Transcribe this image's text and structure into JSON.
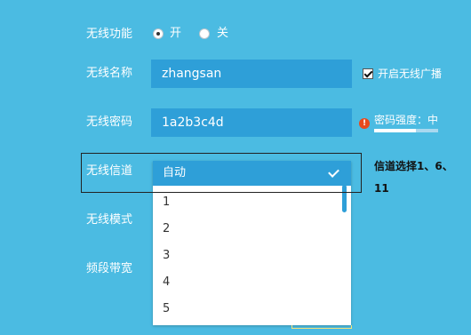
{
  "wireless_function": {
    "label": "无线功能",
    "on_label": "开",
    "off_label": "关",
    "selected": "开"
  },
  "wireless_name": {
    "label": "无线名称",
    "value": "zhangsan",
    "broadcast_label": "开启无线广播",
    "broadcast_checked": true
  },
  "wireless_password": {
    "label": "无线密码",
    "value": "1a2b3c4d",
    "strength_label": "密码强度：中",
    "strength_level": 0.65,
    "warning_icon": "exclamation-icon"
  },
  "wireless_channel": {
    "label": "无线信道",
    "selected": "自动",
    "options": [
      "1",
      "2",
      "3",
      "4",
      "5"
    ],
    "note_line1": "信道选择1、6、",
    "note_line2": "11"
  },
  "wireless_mode": {
    "label": "无线模式"
  },
  "band_width": {
    "label": "频段带宽"
  },
  "colors": {
    "background": "#4bbbe2",
    "field": "#2e9fd8",
    "warning": "#e8491d"
  }
}
